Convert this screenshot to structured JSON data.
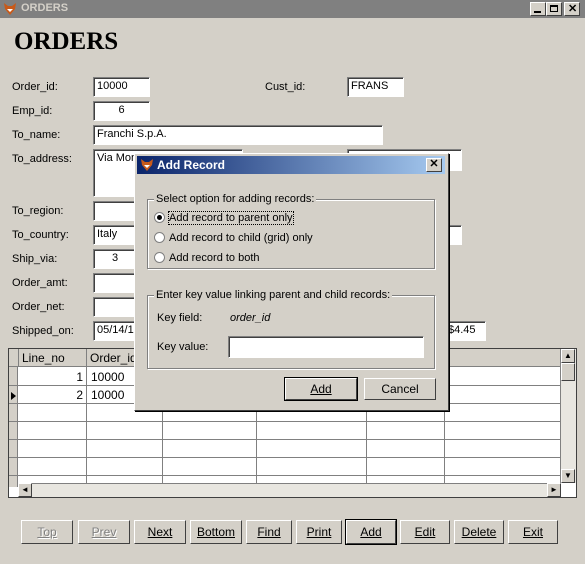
{
  "window": {
    "title": "ORDERS",
    "min": "_",
    "max": "□",
    "close": "✕"
  },
  "form": {
    "title": "ORDERS",
    "labels": {
      "order_id": "Order_id:",
      "cust_id": "Cust_id:",
      "emp_id": "Emp_id:",
      "to_name": "To_name:",
      "to_address": "To_address:",
      "to_region": "To_region:",
      "to_country": "To_country:",
      "ship_via": "Ship_via:",
      "order_amt": "Order_amt:",
      "order_net": "Order_net:",
      "shipped_on": "Shipped_on:"
    },
    "values": {
      "order_id": "10000",
      "cust_id": "FRANS",
      "emp_id": "6",
      "to_name": "Franchi S.p.A.",
      "to_address": "Via Mon",
      "to_region": "",
      "to_country": "Italy",
      "ship_via": "3",
      "order_amt": "",
      "order_net": "",
      "shipped_on": "05/14/1",
      "amount_right": "$4.45"
    }
  },
  "grid": {
    "columns": [
      "Line_no",
      "Order_id"
    ],
    "rows": [
      {
        "line_no": "1",
        "order_id": "10000"
      },
      {
        "line_no": "2",
        "order_id": "10000"
      }
    ]
  },
  "nav_buttons": {
    "top": "Top",
    "prev": "Prev",
    "next": "Next",
    "bottom": "Bottom",
    "find": "Find",
    "print": "Print",
    "add": "Add",
    "edit": "Edit",
    "delete": "Delete",
    "exit": "Exit"
  },
  "dialog": {
    "title": "Add Record",
    "close": "✕",
    "options_group": "Select option for adding records:",
    "options": [
      "Add record to parent only",
      "Add record to child (grid) only",
      "Add record to both"
    ],
    "selected_option": "Add record to parent only",
    "key_group": "Enter key value linking parent and child records:",
    "key_field_label": "Key field:",
    "key_field_value": "order_id",
    "key_value_label": "Key value:",
    "key_value": "",
    "add_label": "Add",
    "cancel_label": "Cancel"
  }
}
